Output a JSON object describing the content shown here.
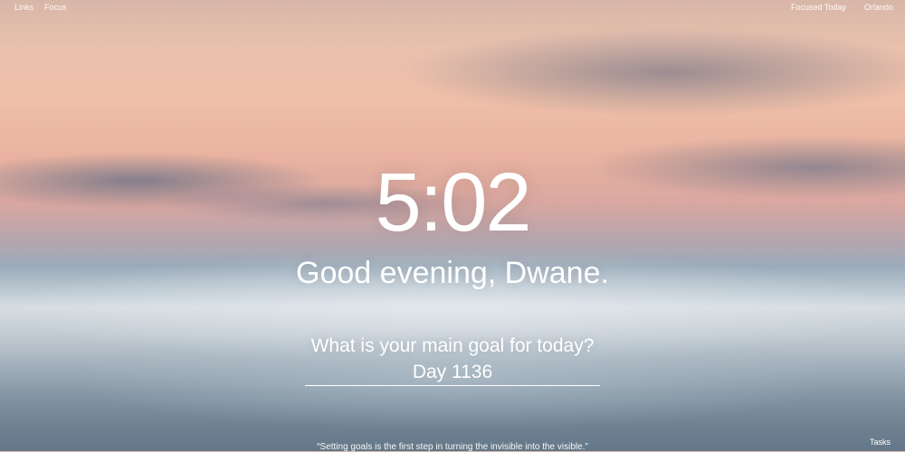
{
  "nav": {
    "links_label": "Links",
    "focus_label": "Focus",
    "focused_today_label": "Focused Today",
    "location_label": "Orlando"
  },
  "center": {
    "time": "5:02",
    "greeting": "Good evening, Dwane.",
    "goal_question": "What is your main goal for today?",
    "goal_value": "Day 1136"
  },
  "footer": {
    "quote": "“Setting goals is the first step in turning the invisible into the visible.”",
    "tasks_label": "Tasks"
  }
}
